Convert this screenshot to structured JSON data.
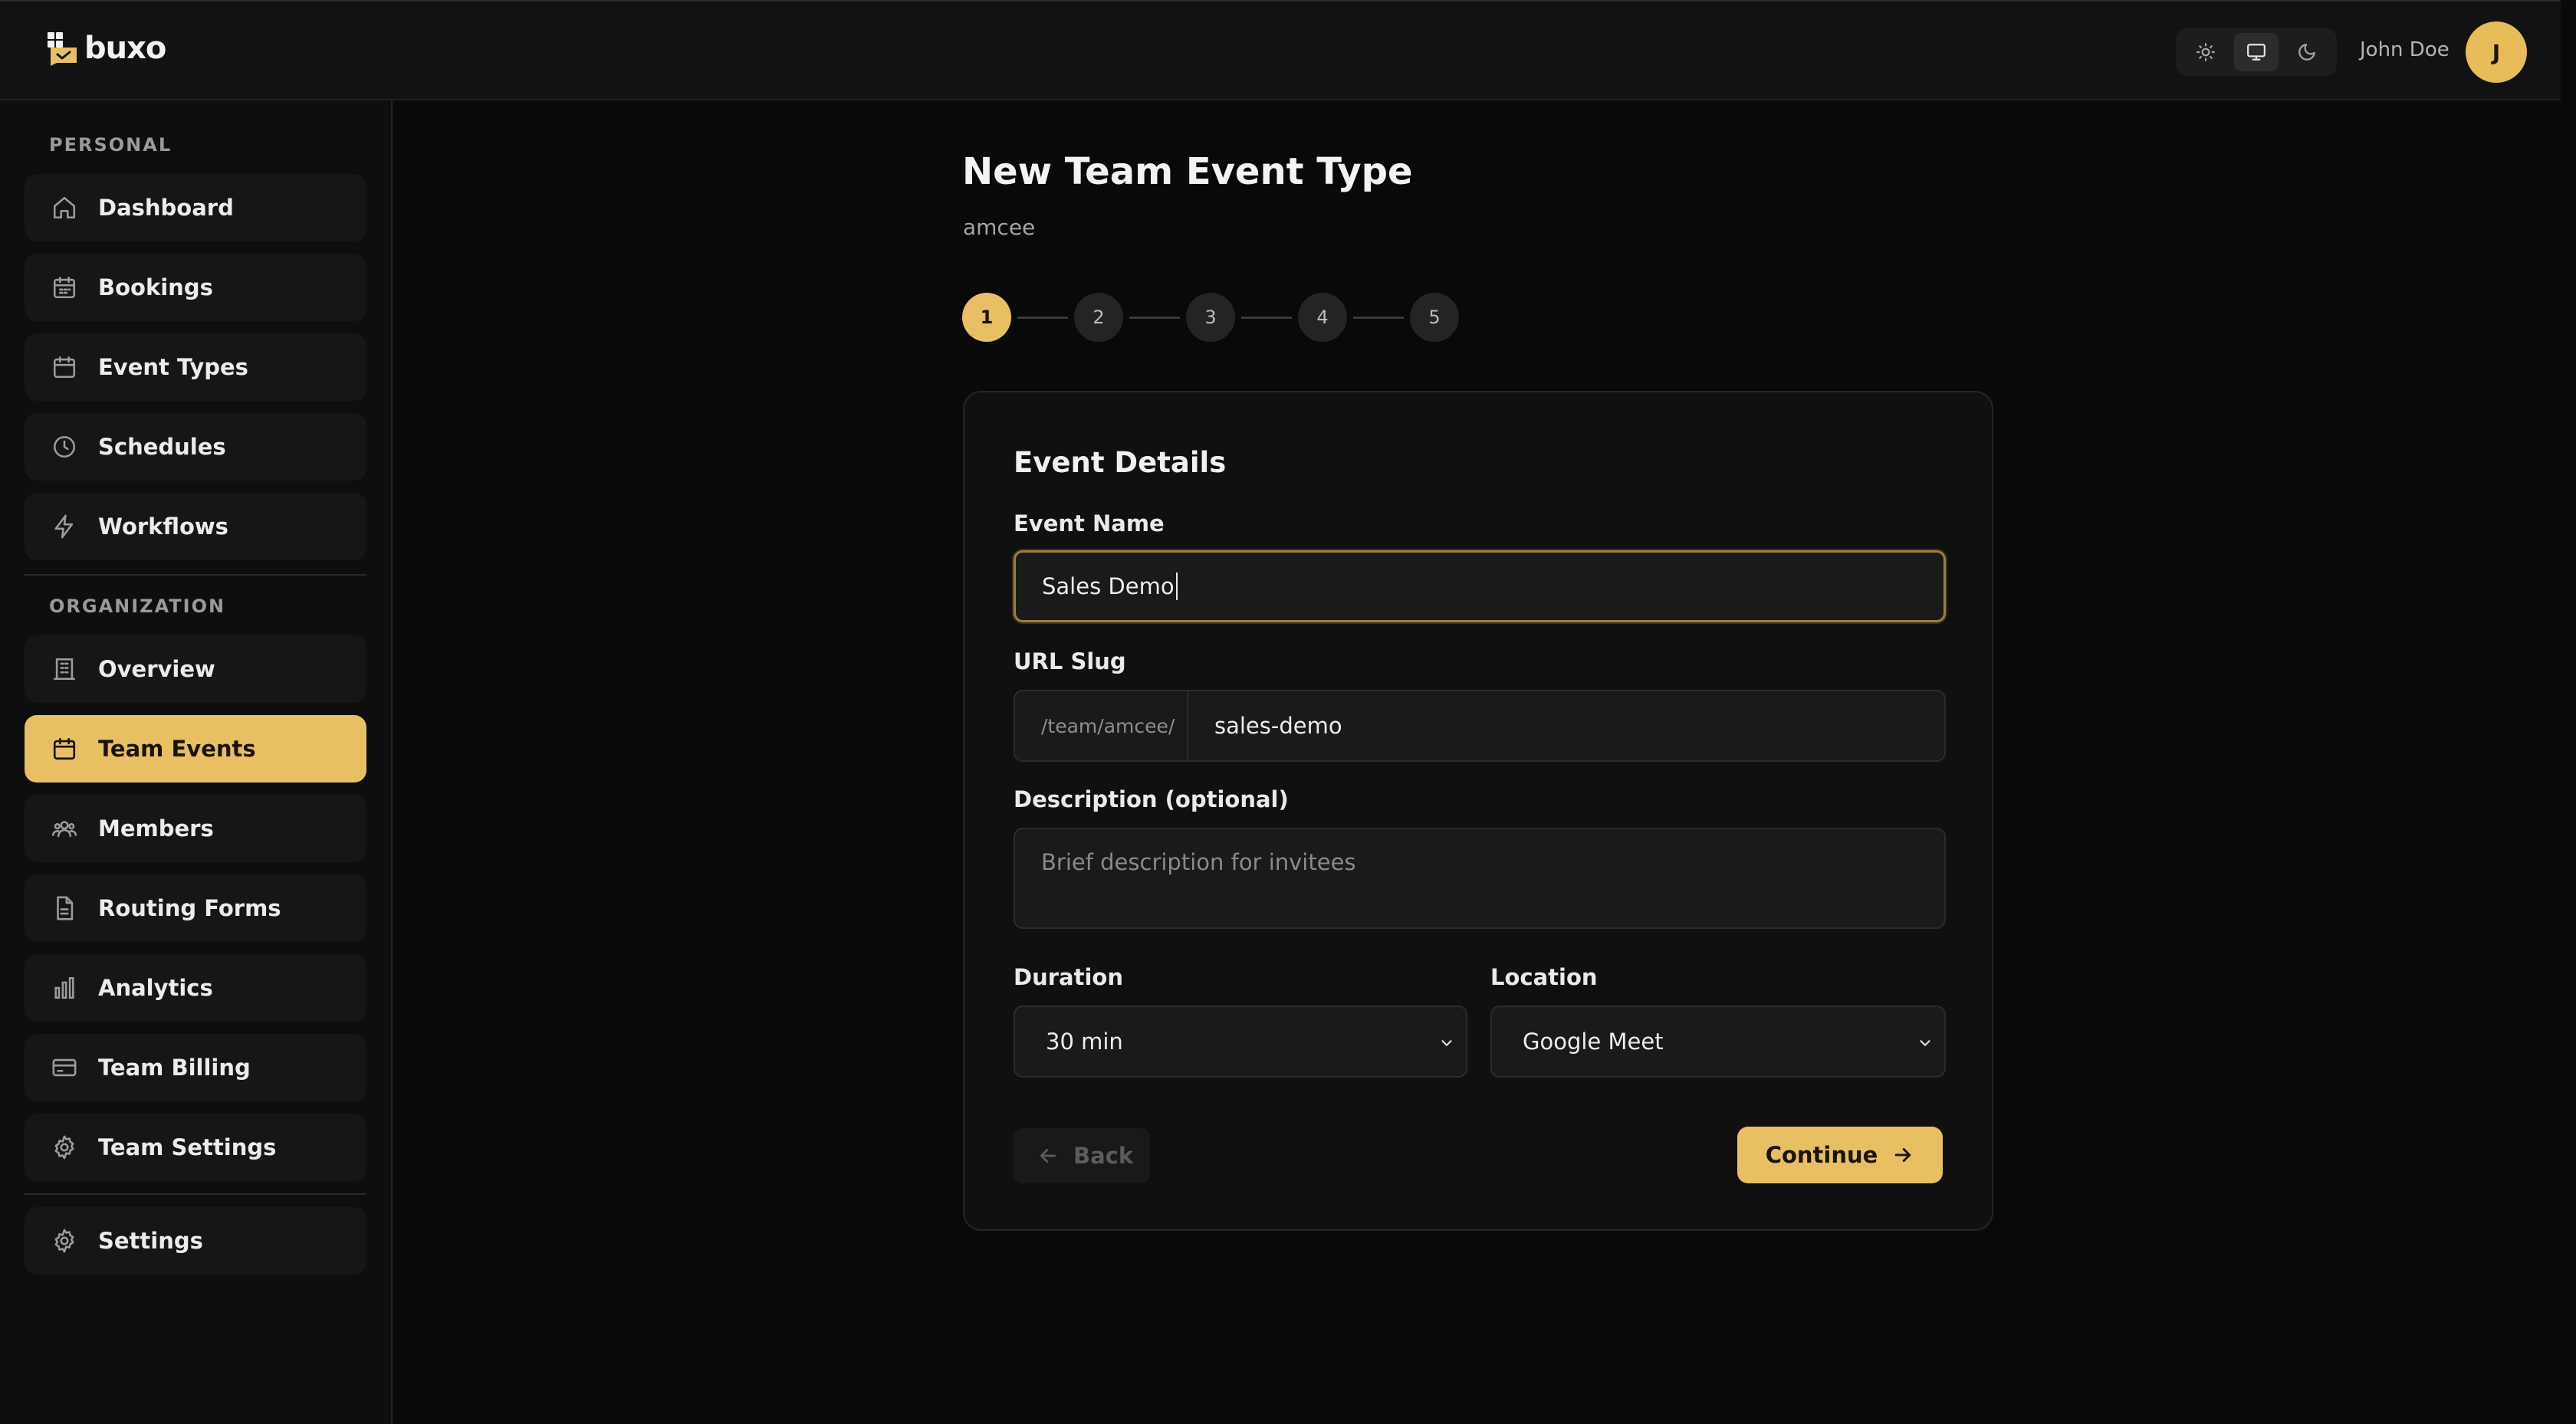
{
  "app": {
    "name": "buxo"
  },
  "header": {
    "theme_options": [
      "light-icon",
      "desktop-icon",
      "moon-icon"
    ],
    "theme_selected": "desktop-icon",
    "user_name": "John Doe",
    "avatar_initial": "J"
  },
  "sidebar": {
    "personal_label": "PERSONAL",
    "personal_items": [
      {
        "label": "Dashboard",
        "icon": "home-icon"
      },
      {
        "label": "Bookings",
        "icon": "calendar-icon"
      },
      {
        "label": "Event Types",
        "icon": "calendar-icon"
      },
      {
        "label": "Schedules",
        "icon": "clock-icon"
      },
      {
        "label": "Workflows",
        "icon": "lightning-icon"
      }
    ],
    "organization_label": "ORGANIZATION",
    "organization_items": [
      {
        "label": "Overview",
        "icon": "building-icon"
      },
      {
        "label": "Team Events",
        "icon": "calendar-icon",
        "active": true
      },
      {
        "label": "Members",
        "icon": "users-icon"
      },
      {
        "label": "Routing Forms",
        "icon": "document-icon"
      },
      {
        "label": "Analytics",
        "icon": "bar-chart-icon"
      },
      {
        "label": "Team Billing",
        "icon": "credit-card-icon"
      },
      {
        "label": "Team Settings",
        "icon": "gear-icon"
      }
    ],
    "bottom_items": [
      {
        "label": "Settings",
        "icon": "gear-icon"
      }
    ]
  },
  "main": {
    "title": "New Team Event Type",
    "subtitle": "amcee",
    "steps": [
      "1",
      "2",
      "3",
      "4",
      "5"
    ],
    "current_step": 1
  },
  "form": {
    "section_title": "Event Details",
    "event_name_label": "Event Name",
    "event_name_value": "Sales Demo",
    "url_slug_label": "URL Slug",
    "url_slug_prefix": "/team/amcee/",
    "url_slug_value": "sales-demo",
    "description_label": "Description (optional)",
    "description_placeholder": "Brief description for invitees",
    "duration_label": "Duration",
    "duration_value": "30 min",
    "location_label": "Location",
    "location_value": "Google Meet",
    "back_label": "Back",
    "continue_label": "Continue"
  },
  "colors": {
    "accent": "#e8c063",
    "background": "#09090a",
    "surface": "#101011"
  }
}
